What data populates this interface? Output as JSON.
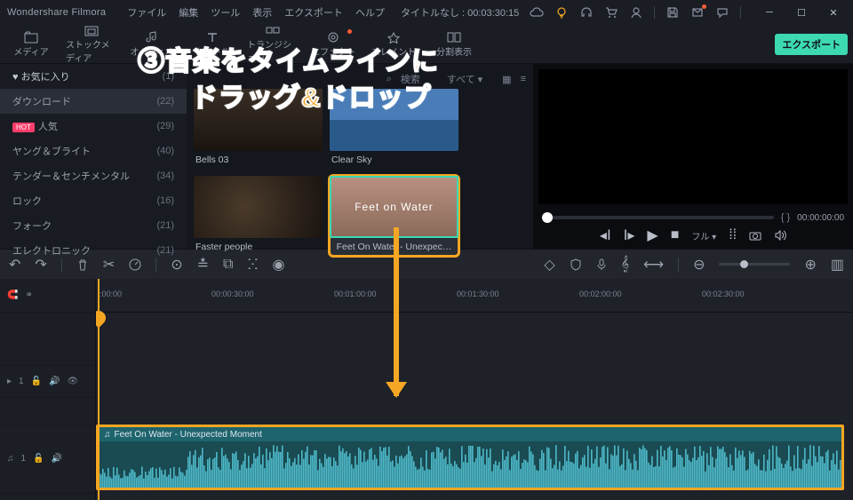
{
  "app": {
    "name": "Wondershare Filmora"
  },
  "menu": [
    "ファイル",
    "編集",
    "ツール",
    "表示",
    "エクスポート",
    "ヘルプ"
  ],
  "document": {
    "title_prefix": "タイトルなし :",
    "duration": "00:03:30:15"
  },
  "toptabs": [
    {
      "label": "メディア"
    },
    {
      "label": "ストックメディア"
    },
    {
      "label": "オーディオ"
    },
    {
      "label": "タイトル"
    },
    {
      "label": "トランジション"
    },
    {
      "label": "エフェクト"
    },
    {
      "label": "エレメント"
    },
    {
      "label": "分割表示"
    }
  ],
  "export_label": "エクスポート",
  "sidebar": {
    "items": [
      {
        "label": "お気に入り",
        "count": "(1)",
        "header": true
      },
      {
        "label": "ダウンロード",
        "count": "(22)",
        "active": true
      },
      {
        "label": "人気",
        "count": "(29)",
        "hot": true
      },
      {
        "label": "ヤング＆ブライト",
        "count": "(40)"
      },
      {
        "label": "テンダー＆センチメンタル",
        "count": "(34)"
      },
      {
        "label": "ロック",
        "count": "(16)"
      },
      {
        "label": "フォーク",
        "count": "(21)"
      },
      {
        "label": "エレクトロニック",
        "count": "(21)"
      }
    ]
  },
  "grid_toolbar": {
    "search_placeholder": "検索",
    "sort": "すべて"
  },
  "clips": [
    {
      "label": "Bells 03"
    },
    {
      "label": "Clear Sky"
    },
    {
      "label": "Faster people"
    },
    {
      "label": "Feet On Water - Unexpec…",
      "overlay_text": "Feet on Water",
      "highlight": true
    }
  ],
  "preview": {
    "time": "00:00:00:00",
    "braces": "{   }",
    "full_label": "フル"
  },
  "ruler_ticks": [
    {
      "pos": 0,
      "label": ":00:00"
    },
    {
      "pos": 130,
      "label": "00:00:30:00"
    },
    {
      "pos": 268,
      "label": "00:01:00:00"
    },
    {
      "pos": 406,
      "label": "00:01:30:00"
    },
    {
      "pos": 544,
      "label": "00:02:00:00"
    },
    {
      "pos": 682,
      "label": "00:02:30:00"
    }
  ],
  "audio_track": {
    "clip_title": "Feet On Water - Unexpected Moment"
  },
  "annotation": {
    "line1": "③音楽をタイムラインに",
    "line2": "ドラッグ&ドロップ"
  },
  "colors": {
    "accent": "#3dd9b0",
    "highlight": "#f5a623",
    "hot": "#ff3d6b"
  }
}
